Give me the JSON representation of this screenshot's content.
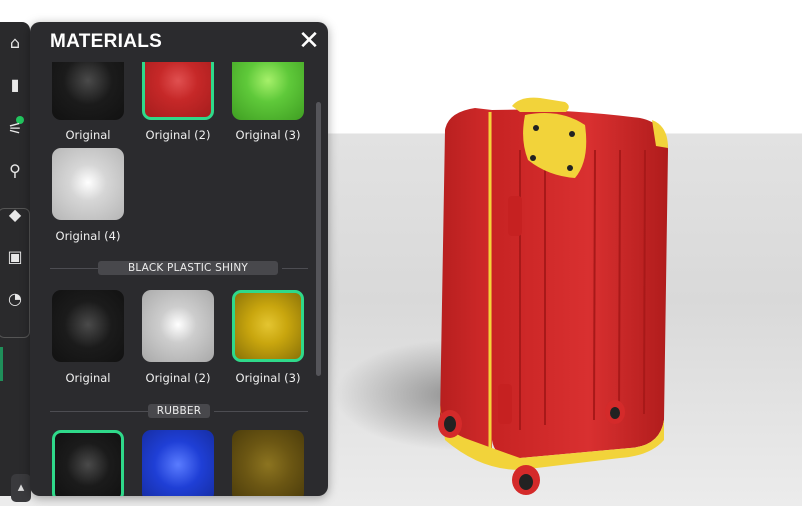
{
  "panel": {
    "title": "MATERIALS",
    "close_glyph": "✕",
    "groups": [
      {
        "swatches": [
          {
            "label": "Original",
            "color": "#1b1b1b",
            "selected": false
          },
          {
            "label": "Original (2)",
            "color": "#c62828",
            "selected": true
          },
          {
            "label": "Original (3)",
            "color": "#5fc93a",
            "selected": false
          },
          {
            "label": "Original (4)",
            "color": "#cfcfcf",
            "selected": false
          }
        ]
      },
      {
        "name": "BLACK PLASTIC SHINY",
        "swatches": [
          {
            "label": "Original",
            "color": "#1b1b1b",
            "selected": false
          },
          {
            "label": "Original (2)",
            "color": "#cdcdcd",
            "selected": false
          },
          {
            "label": "Original (3)",
            "color": "#c9a60e",
            "selected": true
          }
        ]
      },
      {
        "name": "RUBBER",
        "swatches": [
          {
            "color": "#1b1b1b",
            "selected": true
          },
          {
            "color": "#1f3fd6",
            "selected": false
          },
          {
            "color": "#6b5613",
            "selected": false
          }
        ]
      }
    ]
  },
  "toolbar": {
    "icons": [
      "home-icon",
      "bag-icon",
      "sliders-icon",
      "share-icon",
      "tag-icon",
      "camera-icon",
      "palette-icon",
      "expand-icon"
    ],
    "accent": "#22c55e"
  },
  "scene": {
    "object": "suitcase",
    "body_color": "#d42a2a",
    "trim_color": "#f2d33a",
    "wheel_color": "#d42a2a",
    "floor_color": "#dcdcdc"
  }
}
